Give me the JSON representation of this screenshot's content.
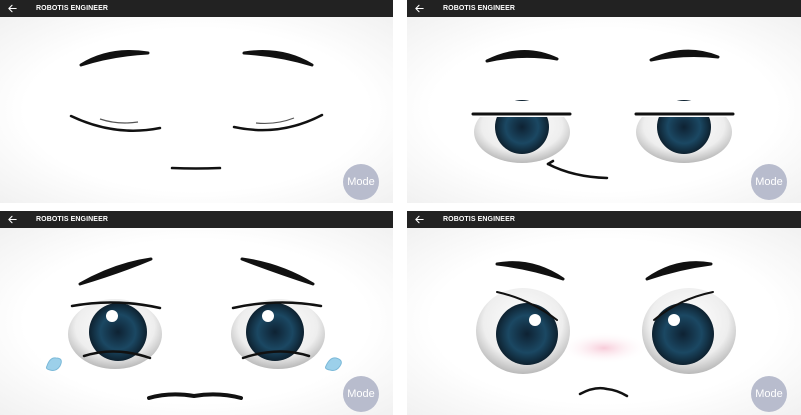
{
  "panels": [
    {
      "app_title": "ROBOTIS ENGINEER",
      "mode_label": "Mode"
    },
    {
      "app_title": "ROBOTIS ENGINEER",
      "mode_label": "Mode"
    },
    {
      "app_title": "ROBOTIS ENGINEER",
      "mode_label": "Mode"
    },
    {
      "app_title": "ROBOTIS ENGINEER",
      "mode_label": "Mode"
    }
  ],
  "colors": {
    "appbar": "#222222",
    "mode_button": "#b8bccd",
    "iris": "#1d4a63",
    "tear": "#9cd0ea",
    "blush": "#f6c6d4"
  },
  "icons": [
    "back-arrow-icon"
  ]
}
